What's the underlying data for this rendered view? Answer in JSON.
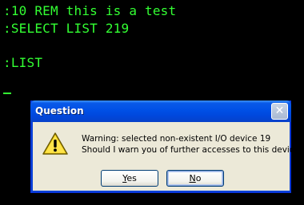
{
  "terminal": {
    "lines": [
      ":10 REM this is a test",
      ":SELECT LIST 219",
      ":LIST"
    ],
    "text_color": "#33ff33",
    "background": "#000000"
  },
  "dialog": {
    "title": "Question",
    "icon": "warning-icon",
    "message_line1": "Warning: selected non-existent I/O device 19",
    "message_line2": "Should I warn you of further accesses to this device?",
    "buttons": {
      "yes": {
        "accel": "Y",
        "rest": "es"
      },
      "no": {
        "accel": "N",
        "rest": "o"
      }
    },
    "close_icon": "close-icon",
    "title_bar_color": "#0050e6",
    "body_color": "#ece9d8"
  }
}
